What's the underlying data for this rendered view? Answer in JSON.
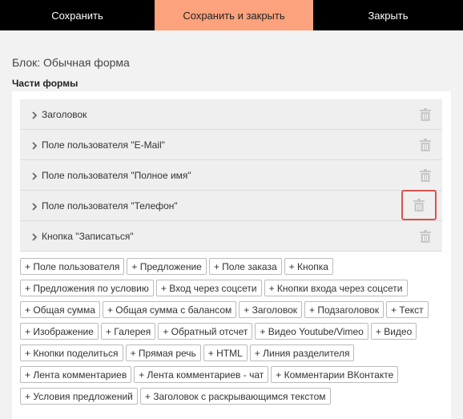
{
  "toolbar": {
    "save_label": "Сохранить",
    "save_close_label": "Сохранить и закрыть",
    "close_label": "Закрыть",
    "accent_color": "#fca27c"
  },
  "block_title": "Блок: Обычная форма",
  "section_title": "Части формы",
  "parts": [
    {
      "label": "Заголовок"
    },
    {
      "label": "Поле пользователя \"E-Mail\""
    },
    {
      "label": "Поле пользователя \"Полное имя\""
    },
    {
      "label": "Поле пользователя \"Телефон\""
    },
    {
      "label": "Кнопка \"Записаться\""
    }
  ],
  "add_buttons": [
    [
      "+ Поле пользователя",
      "+ Предложение",
      "+ Поле заказа",
      "+ Кнопка"
    ],
    [
      "+ Предложения по условию",
      "+ Вход через соцсети",
      "+ Кнопки входа через соцсети"
    ],
    [
      "+ Общая сумма",
      "+ Общая сумма с балансом",
      "+ Заголовок",
      "+ Подзаголовок",
      "+ Текст"
    ],
    [
      "+ Изображение",
      "+ Галерея",
      "+ Обратный отсчет",
      "+ Видео Youtube/Vimeo",
      "+ Видео"
    ],
    [
      "+ Кнопки поделиться",
      "+ Прямая речь",
      "+ HTML",
      "+ Линия разделителя"
    ],
    [
      "+ Лента комментариев",
      "+ Лента комментариев - чат",
      "+ Комментарии ВКонтакте"
    ],
    [
      "+ Условия предложений",
      "+ Заголовок с раскрывающимся текстом"
    ]
  ]
}
